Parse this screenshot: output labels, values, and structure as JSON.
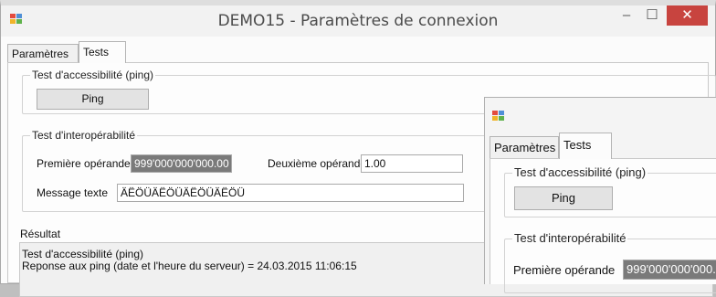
{
  "main_window": {
    "title": "DEMO15 - Paramètres de connexion",
    "controls": {
      "minimize": "–",
      "maximize": "☐",
      "close": "✕"
    },
    "tabs": [
      {
        "label": "Paramètres",
        "active": false
      },
      {
        "label": "Tests",
        "active": true
      }
    ],
    "ping_group": {
      "label": "Test d'accessibilité (ping)",
      "button": "Ping"
    },
    "interop_group": {
      "label": "Test d'interopérabilité",
      "first_operand_label": "Première opérande",
      "first_operand_value": "999'000'000'000.00",
      "second_operand_label": "Deuxième opérande",
      "second_operand_value": "1.00",
      "message_label": "Message texte",
      "message_value": "ÄËÖÜÄËÖÜÄËÖÜÄËÖÜ"
    },
    "result": {
      "label": "Résultat",
      "lines": [
        "Test d'accessibilité (ping)",
        "Reponse aux ping (date et l'heure du serveur) = 24.03.2015 11:06:15"
      ]
    }
  },
  "second_window": {
    "tabs": [
      {
        "label": "Paramètres",
        "active": false
      },
      {
        "label": "Tests",
        "active": true
      }
    ],
    "ping_group": {
      "label": "Test d'accessibilité (ping)",
      "button": "Ping"
    },
    "interop_group": {
      "label": "Test d'interopérabilité",
      "first_operand_label": "Première opérande",
      "first_operand_value": "999'000'000'000.0"
    }
  },
  "colors": {
    "close_button": "#c8443f",
    "selected_field": "#7a7a7a"
  },
  "icons": [
    "app-icon",
    "minimize-icon",
    "maximize-icon",
    "close-icon"
  ]
}
